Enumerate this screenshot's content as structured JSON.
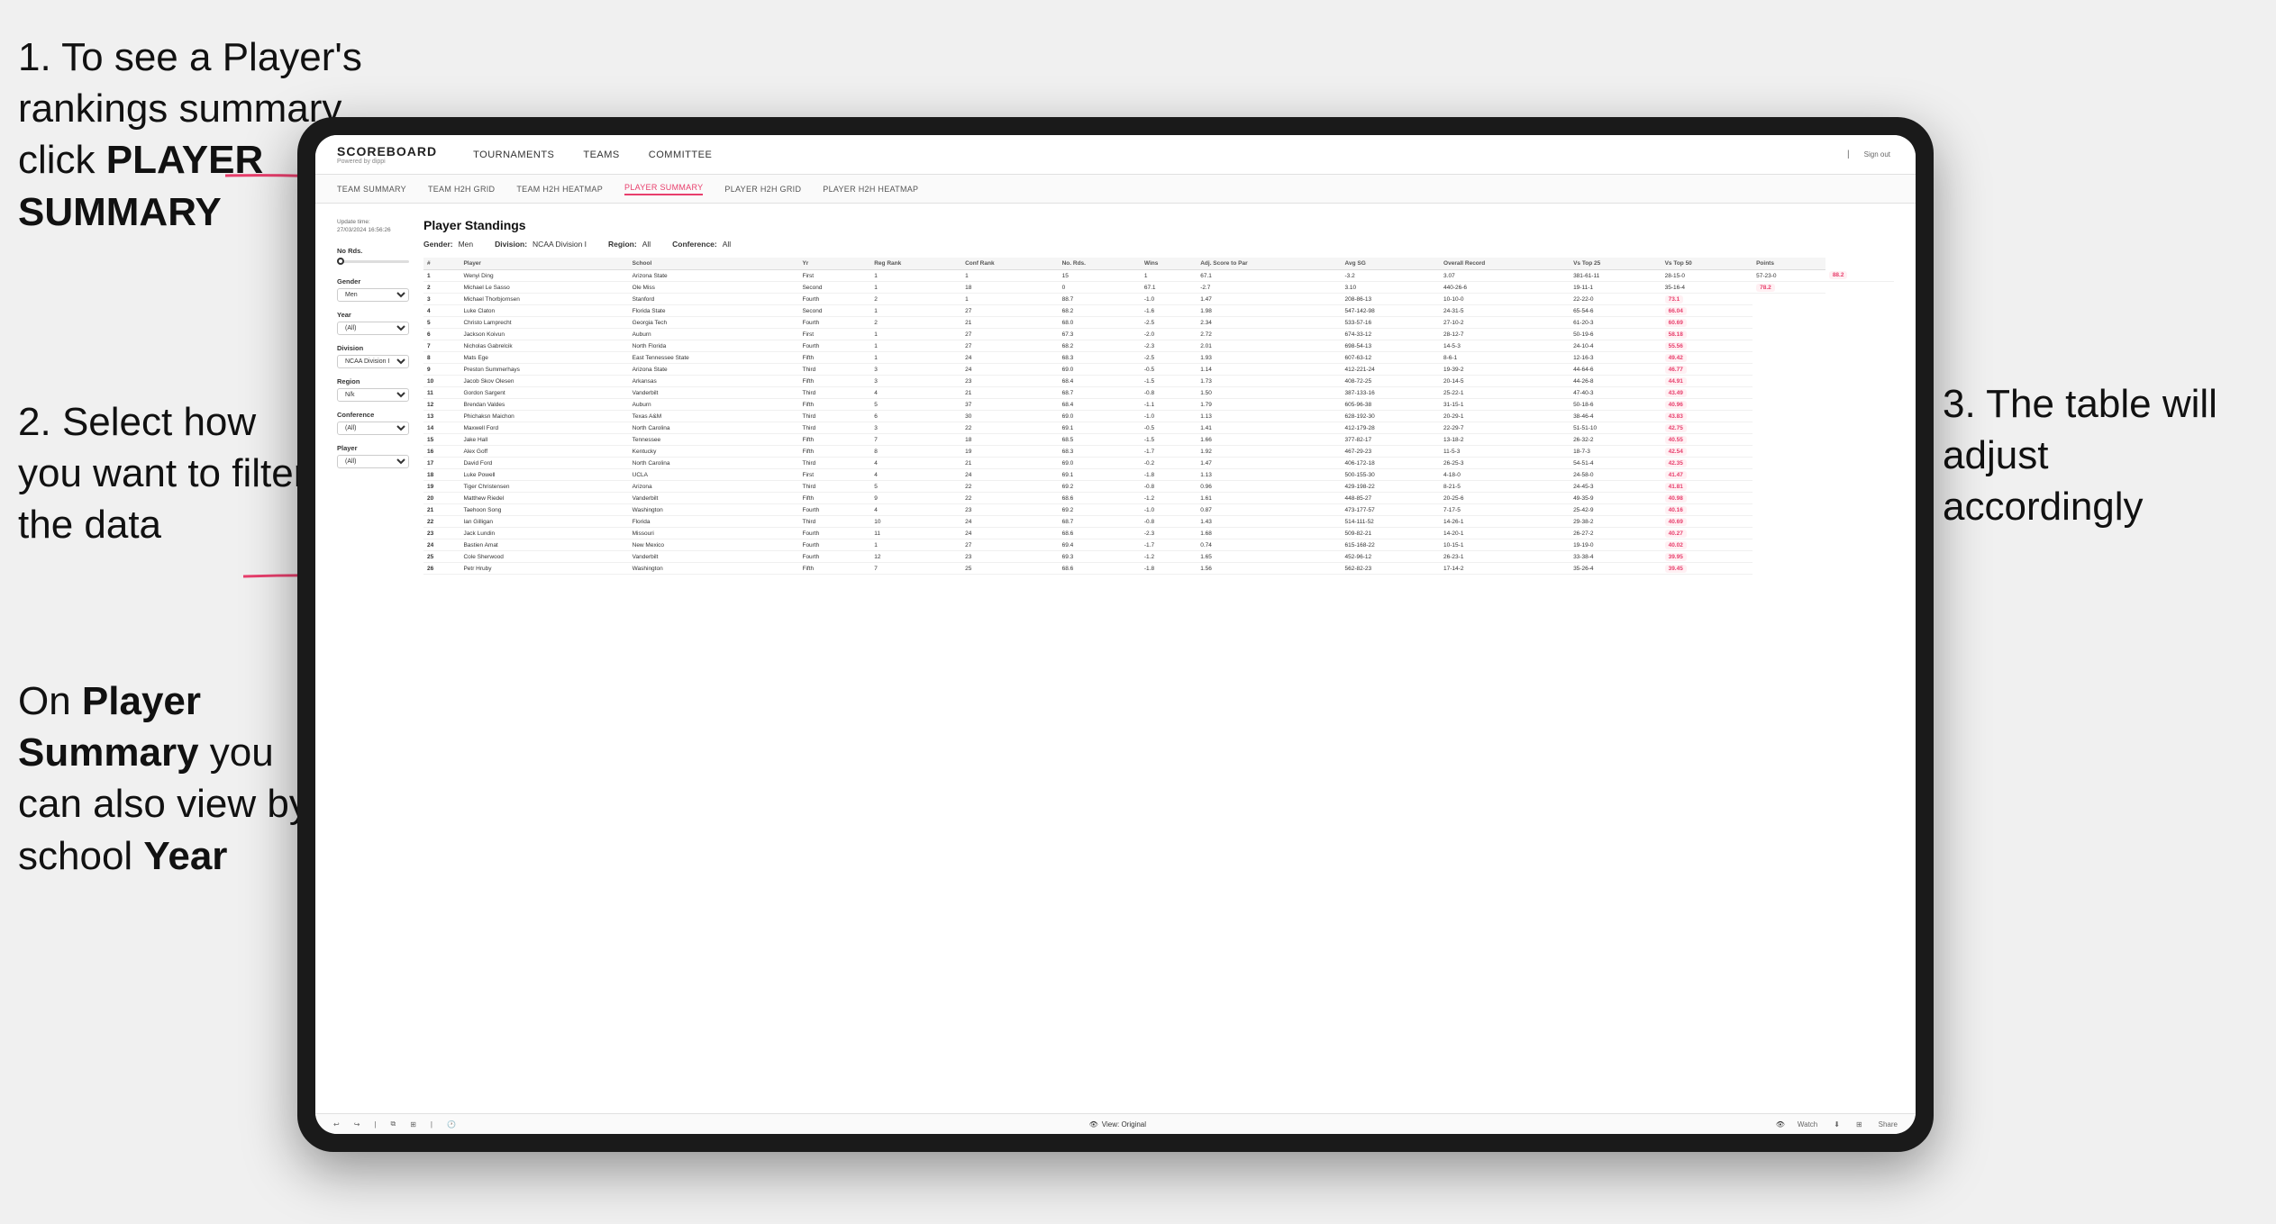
{
  "instructions": {
    "step1": {
      "number": "1.",
      "text": "To see a Player's rankings summary click ",
      "bold": "PLAYER SUMMARY"
    },
    "step2": {
      "number": "2.",
      "text": "Select how you want to filter the data"
    },
    "step3": {
      "number": "3.",
      "text": "The table will adjust accordingly"
    },
    "bottom": {
      "text": "On ",
      "bold1": "Player Summary",
      "text2": " you can also view by school ",
      "bold2": "Year"
    }
  },
  "app": {
    "logo": "SCOREBOARD",
    "logo_sub": "Powered by dippi",
    "sign_out": "Sign out",
    "nav": [
      "TOURNAMENTS",
      "TEAMS",
      "COMMITTEE"
    ],
    "sub_nav": [
      "TEAM SUMMARY",
      "TEAM H2H GRID",
      "TEAM H2H HEATMAP",
      "PLAYER SUMMARY",
      "PLAYER H2H GRID",
      "PLAYER H2H HEATMAP"
    ],
    "active_sub_nav": "PLAYER SUMMARY"
  },
  "content": {
    "title": "Player Standings",
    "update_time_label": "Update time:",
    "update_time": "27/03/2024 16:56:26",
    "filters": {
      "gender_label": "Gender:",
      "gender_value": "Men",
      "division_label": "Division:",
      "division_value": "NCAA Division I",
      "region_label": "Region:",
      "region_value": "All",
      "conference_label": "Conference:",
      "conference_value": "All"
    },
    "left_filters": {
      "no_rds_label": "No Rds.",
      "gender_label": "Gender",
      "gender_options": [
        "Men"
      ],
      "year_label": "Year",
      "year_options": [
        "(All)"
      ],
      "division_label": "Division",
      "division_options": [
        "NCAA Division I"
      ],
      "region_label": "Region",
      "region_options": [
        "N/k"
      ],
      "conference_label": "Conference",
      "conference_options": [
        "(All)"
      ],
      "player_label": "Player",
      "player_options": [
        "(All)"
      ]
    },
    "table": {
      "columns": [
        "#",
        "Player",
        "School",
        "Yr",
        "Reg Rank",
        "Conf Rank",
        "No. Rds.",
        "Wins",
        "Adj. Score to Par",
        "Avg SG",
        "Overall Record",
        "Vs Top 25",
        "Vs Top 50",
        "Points"
      ],
      "rows": [
        [
          "1",
          "Wenyi Ding",
          "Arizona State",
          "First",
          "1",
          "1",
          "15",
          "1",
          "67.1",
          "-3.2",
          "3.07",
          "381-61-11",
          "28-15-0",
          "57-23-0",
          "88.2"
        ],
        [
          "2",
          "Michael Le Sasso",
          "Ole Miss",
          "Second",
          "1",
          "18",
          "0",
          "67.1",
          "-2.7",
          "3.10",
          "440-26-6",
          "19-11-1",
          "35-16-4",
          "78.2"
        ],
        [
          "3",
          "Michael Thorbjornsen",
          "Stanford",
          "Fourth",
          "2",
          "1",
          "88.7",
          "-1.0",
          "1.47",
          "208-86-13",
          "10-10-0",
          "22-22-0",
          "73.1"
        ],
        [
          "4",
          "Luke Claton",
          "Florida State",
          "Second",
          "1",
          "27",
          "68.2",
          "-1.6",
          "1.98",
          "547-142-98",
          "24-31-5",
          "65-54-6",
          "66.04"
        ],
        [
          "5",
          "Christo Lamprecht",
          "Georgia Tech",
          "Fourth",
          "2",
          "21",
          "68.0",
          "-2.5",
          "2.34",
          "533-57-16",
          "27-10-2",
          "61-20-3",
          "60.69"
        ],
        [
          "6",
          "Jackson Koivun",
          "Auburn",
          "First",
          "1",
          "27",
          "67.3",
          "-2.0",
          "2.72",
          "674-33-12",
          "28-12-7",
          "50-19-6",
          "58.18"
        ],
        [
          "7",
          "Nicholas Gabrelcik",
          "North Florida",
          "Fourth",
          "1",
          "27",
          "68.2",
          "-2.3",
          "2.01",
          "698-54-13",
          "14-5-3",
          "24-10-4",
          "55.56"
        ],
        [
          "8",
          "Mats Ege",
          "East Tennessee State",
          "Fifth",
          "1",
          "24",
          "68.3",
          "-2.5",
          "1.93",
          "607-63-12",
          "8-6-1",
          "12-16-3",
          "49.42"
        ],
        [
          "9",
          "Preston Summerhays",
          "Arizona State",
          "Third",
          "3",
          "24",
          "69.0",
          "-0.5",
          "1.14",
          "412-221-24",
          "19-39-2",
          "44-64-6",
          "46.77"
        ],
        [
          "10",
          "Jacob Skov Olesen",
          "Arkansas",
          "Fifth",
          "3",
          "23",
          "68.4",
          "-1.5",
          "1.73",
          "408-72-25",
          "20-14-5",
          "44-26-8",
          "44.91"
        ],
        [
          "11",
          "Gordon Sargent",
          "Vanderbilt",
          "Third",
          "4",
          "21",
          "68.7",
          "-0.8",
          "1.50",
          "387-133-16",
          "25-22-1",
          "47-40-3",
          "43.49"
        ],
        [
          "12",
          "Brendan Valdes",
          "Auburn",
          "Fifth",
          "5",
          "37",
          "68.4",
          "-1.1",
          "1.79",
          "605-96-38",
          "31-15-1",
          "50-18-6",
          "40.96"
        ],
        [
          "13",
          "Phichaksn Maichon",
          "Texas A&M",
          "Third",
          "6",
          "30",
          "69.0",
          "-1.0",
          "1.13",
          "628-192-30",
          "20-29-1",
          "38-46-4",
          "43.83"
        ],
        [
          "14",
          "Maxwell Ford",
          "North Carolina",
          "Third",
          "3",
          "22",
          "69.1",
          "-0.5",
          "1.41",
          "412-179-28",
          "22-29-7",
          "51-51-10",
          "42.75"
        ],
        [
          "15",
          "Jake Hall",
          "Tennessee",
          "Fifth",
          "7",
          "18",
          "68.5",
          "-1.5",
          "1.66",
          "377-82-17",
          "13-18-2",
          "26-32-2",
          "40.55"
        ],
        [
          "16",
          "Alex Goff",
          "Kentucky",
          "Fifth",
          "8",
          "19",
          "68.3",
          "-1.7",
          "1.92",
          "467-29-23",
          "11-5-3",
          "18-7-3",
          "42.54"
        ],
        [
          "17",
          "David Ford",
          "North Carolina",
          "Third",
          "4",
          "21",
          "69.0",
          "-0.2",
          "1.47",
          "406-172-18",
          "26-25-3",
          "54-51-4",
          "42.35"
        ],
        [
          "18",
          "Luke Powell",
          "UCLA",
          "First",
          "4",
          "24",
          "69.1",
          "-1.8",
          "1.13",
          "500-155-30",
          "4-18-0",
          "24-58-0",
          "41.47"
        ],
        [
          "19",
          "Tiger Christensen",
          "Arizona",
          "Third",
          "5",
          "22",
          "69.2",
          "-0.8",
          "0.96",
          "429-198-22",
          "8-21-5",
          "24-45-3",
          "41.81"
        ],
        [
          "20",
          "Matthew Riedel",
          "Vanderbilt",
          "Fifth",
          "9",
          "22",
          "68.6",
          "-1.2",
          "1.61",
          "448-85-27",
          "20-25-6",
          "49-35-9",
          "40.98"
        ],
        [
          "21",
          "Taehoon Song",
          "Washington",
          "Fourth",
          "4",
          "23",
          "69.2",
          "-1.0",
          "0.87",
          "473-177-57",
          "7-17-5",
          "25-42-9",
          "40.16"
        ],
        [
          "22",
          "Ian Gilligan",
          "Florida",
          "Third",
          "10",
          "24",
          "68.7",
          "-0.8",
          "1.43",
          "514-111-52",
          "14-26-1",
          "29-38-2",
          "40.69"
        ],
        [
          "23",
          "Jack Lundin",
          "Missouri",
          "Fourth",
          "11",
          "24",
          "68.6",
          "-2.3",
          "1.68",
          "509-82-21",
          "14-20-1",
          "26-27-2",
          "40.27"
        ],
        [
          "24",
          "Bastien Amat",
          "New Mexico",
          "Fourth",
          "1",
          "27",
          "69.4",
          "-1.7",
          "0.74",
          "615-168-22",
          "10-15-1",
          "19-19-0",
          "40.02"
        ],
        [
          "25",
          "Cole Sherwood",
          "Vanderbilt",
          "Fourth",
          "12",
          "23",
          "69.3",
          "-1.2",
          "1.65",
          "452-96-12",
          "26-23-1",
          "33-38-4",
          "39.95"
        ],
        [
          "26",
          "Petr Hruby",
          "Washington",
          "Fifth",
          "7",
          "25",
          "68.6",
          "-1.8",
          "1.56",
          "562-82-23",
          "17-14-2",
          "35-26-4",
          "39.45"
        ]
      ]
    },
    "toolbar": {
      "view_label": "View: Original",
      "watch_label": "Watch",
      "share_label": "Share"
    }
  }
}
